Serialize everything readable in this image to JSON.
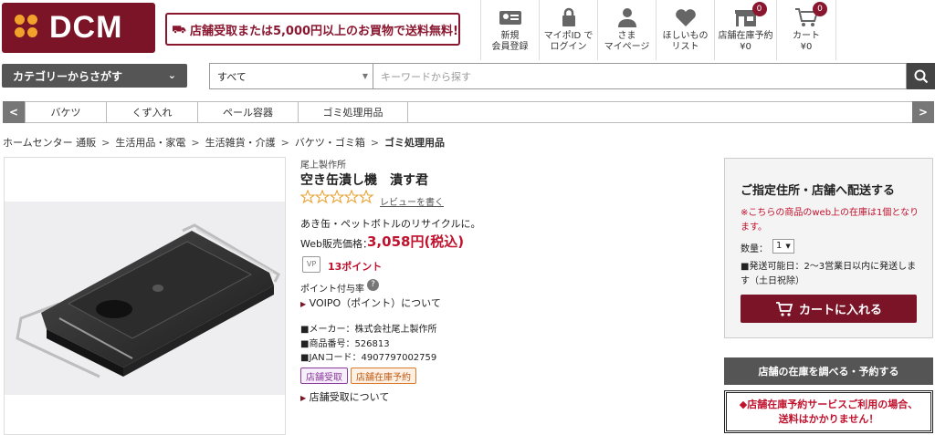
{
  "header": {
    "logo_text": "DCM",
    "promo": "店舗受取または5,000円以上のお買物で送料無料!",
    "nav": [
      {
        "label": "新規\n会員登録",
        "icon": "id-card-icon"
      },
      {
        "label": "マイポID で\nログイン",
        "icon": "lock-icon"
      },
      {
        "label": "さま\nマイページ",
        "icon": "user-icon"
      },
      {
        "label": "ほしいもの\nリスト",
        "icon": "heart-icon"
      },
      {
        "label": "店舗在庫予約\n¥0",
        "icon": "store-icon",
        "badge": "0"
      },
      {
        "label": "カート\n¥0",
        "icon": "cart-icon",
        "badge": "0"
      }
    ]
  },
  "search": {
    "category_button": "カテゴリーからさがす",
    "select_value": "すべて",
    "placeholder": "キーワードから探す"
  },
  "category_strip": {
    "prev": "<",
    "next": ">",
    "tabs": [
      "バケツ",
      "くず入れ",
      "ペール容器",
      "ゴミ処理用品"
    ]
  },
  "breadcrumb": [
    "ホームセンター 通販",
    "生活用品・家電",
    "生活雑貨・介護",
    "バケツ・ゴミ箱",
    "ゴミ処理用品"
  ],
  "breadcrumb_sep": ">",
  "product": {
    "maker": "尾上製作所",
    "name": "空き缶潰し機　潰す君",
    "review_link": "レビューを書く",
    "rating": 0,
    "description": "あき缶・ペットボトルのリサイクルに。",
    "price_label": "Web販売価格：",
    "price": "3,058円(税込)",
    "points_icon": "VP",
    "points": "13ポイント",
    "points_rate": "ポイント付与率",
    "points_help": "?",
    "voipo_link": "VOIPO（ポイント）について",
    "spec_maker": "■メーカー：株式会社尾上製作所",
    "spec_number": "■商品番号：526813",
    "spec_jan": "■JANコード：4907797002759",
    "tag_pickup": "店舗受取",
    "tag_reserve": "店舗在庫予約",
    "pickup_link": "店舗受取について"
  },
  "delivery": {
    "title": "ご指定住所・店舗へ配送する",
    "stock_note": "※こちらの商品のweb上の在庫は1個となります。",
    "qty_label": "数量：",
    "qty_value": "1",
    "ship_note": "■発送可能日：2〜3営業日以内に発送します（土日祝除）",
    "cart_button": "カートに入れる",
    "store_button": "店舗の在庫を調べる・予約する",
    "notice_line1": "◆店舗在庫予約サービスご利用の場合、",
    "notice_line2": "送料はかかりません！"
  },
  "colors": {
    "brand": "#7b1427",
    "accent": "#c0112d",
    "logo_dots": "#f2a12a"
  }
}
